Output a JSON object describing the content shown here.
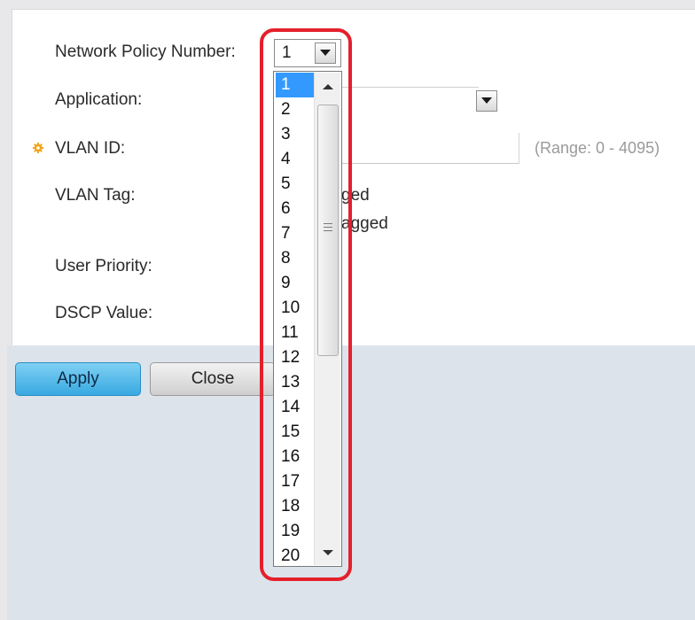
{
  "form": {
    "network_policy_label": "Network Policy Number:",
    "network_policy_value": "1",
    "application_label": "Application:",
    "vlan_id_label": "VLAN ID:",
    "vlan_range_hint": "(Range: 0 - 4095)",
    "vlan_tag_label": "VLAN Tag:",
    "vlan_tag_option_1_fragment": "ged",
    "vlan_tag_option_2_fragment": "agged",
    "user_priority_label": "User Priority:",
    "dscp_value_label": "DSCP Value:"
  },
  "buttons": {
    "apply": "Apply",
    "close": "Close"
  },
  "dropdown": {
    "selected": "1",
    "options": [
      "1",
      "2",
      "3",
      "4",
      "5",
      "6",
      "7",
      "8",
      "9",
      "10",
      "11",
      "12",
      "13",
      "14",
      "15",
      "16",
      "17",
      "18",
      "19",
      "20"
    ]
  },
  "icons": {
    "required": "gear-icon",
    "dropdown_arrow": "chevron-down-icon",
    "scroll_up": "scroll-up-arrow-icon",
    "scroll_down": "scroll-down-arrow-icon"
  },
  "colors": {
    "selection_highlight": "#3399ff",
    "annotation_outline": "#e4202c",
    "apply_button": "#38a9e1",
    "required_icon": "#f2a319"
  }
}
